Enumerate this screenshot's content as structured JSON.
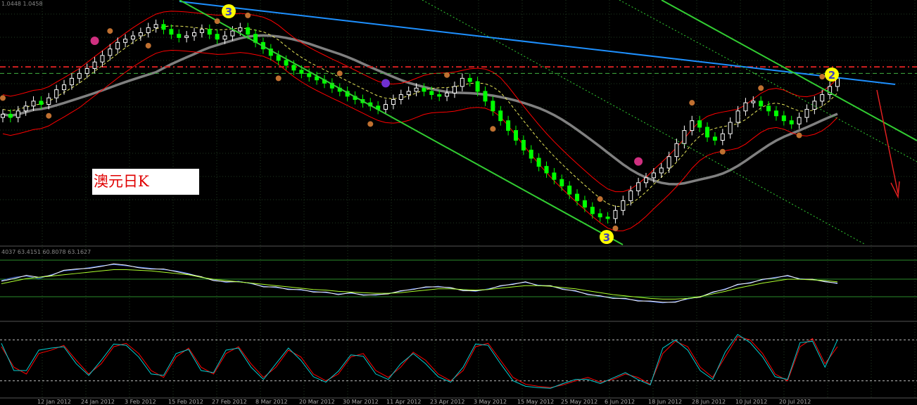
{
  "chart_data": [
    {
      "type": "candlestick",
      "panel": "main",
      "instrument_hint": "AUD daily",
      "header_text": "1.0448 1.0458",
      "annotation_label": "澳元日K",
      "x_tick_labels": [
        "12 Jan 2012",
        "24 Jan 2012",
        "3 Feb 2012",
        "15 Feb 2012",
        "27 Feb 2012",
        "8 Mar 2012",
        "20 Mar 2012",
        "30 Mar 2012",
        "11 Apr 2012",
        "23 Apr 2012",
        "3 May 2012",
        "15 May 2012",
        "25 May 2012",
        "6 Jun 2012",
        "18 Jun 2012",
        "28 Jun 2012",
        "10 Jul 2012",
        "20 Jul 2012"
      ],
      "close_series": [
        1.03,
        1.028,
        1.032,
        1.035,
        1.038,
        1.036,
        1.04,
        1.045,
        1.048,
        1.052,
        1.055,
        1.058,
        1.062,
        1.066,
        1.07,
        1.074,
        1.076,
        1.078,
        1.08,
        1.083,
        1.085,
        1.082,
        1.079,
        1.077,
        1.078,
        1.08,
        1.082,
        1.079,
        1.076,
        1.078,
        1.081,
        1.083,
        1.079,
        1.074,
        1.07,
        1.066,
        1.063,
        1.06,
        1.057,
        1.055,
        1.053,
        1.051,
        1.049,
        1.046,
        1.044,
        1.041,
        1.039,
        1.037,
        1.035,
        1.033,
        1.036,
        1.039,
        1.042,
        1.044,
        1.046,
        1.044,
        1.042,
        1.041,
        1.043,
        1.047,
        1.052,
        1.05,
        1.044,
        1.038,
        1.032,
        1.026,
        1.02,
        1.014,
        1.008,
        1.003,
        0.998,
        0.994,
        0.99,
        0.986,
        0.981,
        0.977,
        0.973,
        0.969,
        0.967,
        0.966,
        0.971,
        0.977,
        0.983,
        0.988,
        0.991,
        0.994,
        0.997,
        1.004,
        1.012,
        1.02,
        1.026,
        1.022,
        1.016,
        1.014,
        1.018,
        1.025,
        1.032,
        1.037,
        1.038,
        1.035,
        1.032,
        1.029,
        1.026,
        1.024,
        1.028,
        1.033,
        1.038,
        1.042,
        1.047,
        1.052
      ],
      "reference_lines": {
        "red_dash_level": 1.059,
        "green_dash_level": 1.055
      },
      "moving_average_grey": "thick grey line",
      "bands": "red envelope lines, yellow dashed mid line",
      "trend_lines": [
        "blue descending resistance",
        "green descending channel",
        "green dotted parallel lines"
      ],
      "markers": [
        {
          "label": "3",
          "color": "yellow",
          "where": "late Feb high"
        },
        {
          "label": "3",
          "color": "yellow",
          "where": "late May low"
        },
        {
          "label": "2",
          "color": "yellow",
          "where": "late Jul"
        }
      ],
      "colors": {
        "up": "#ffffff",
        "down": "#00ff00",
        "band": "#ff0000",
        "ma": "#808080",
        "trend_blue": "#1e90ff",
        "trend_green": "#32cd32"
      }
    },
    {
      "type": "line",
      "panel": "oscillator-1",
      "header_text": "4037 63.4151 60.8078 63.1627",
      "series": [
        {
          "color": "#4169e1",
          "values": [
            55,
            60,
            62,
            58,
            64,
            70,
            72,
            75,
            78,
            80,
            78,
            76,
            74,
            72,
            70,
            66,
            60,
            56,
            52,
            54,
            50,
            46,
            44,
            42,
            40,
            38,
            36,
            34,
            35,
            33,
            32,
            35,
            38,
            42,
            44,
            46,
            43,
            40,
            38,
            42,
            46,
            50,
            52,
            48,
            46,
            42,
            38,
            34,
            30,
            28,
            26,
            24,
            22,
            20,
            22,
            26,
            30,
            36,
            42,
            48,
            52,
            56,
            60,
            62,
            58,
            56,
            54,
            50
          ]
        },
        {
          "color": "#ffffff",
          "values": [
            54,
            58,
            63,
            60,
            63,
            71,
            73,
            74,
            77,
            81,
            79,
            75,
            73,
            73,
            69,
            65,
            61,
            55,
            53,
            53,
            51,
            45,
            45,
            41,
            41,
            37,
            37,
            33,
            36,
            32,
            33,
            34,
            39,
            41,
            45,
            45,
            44,
            39,
            39,
            41,
            47,
            49,
            53,
            47,
            47,
            41,
            39,
            33,
            31,
            27,
            27,
            23,
            23,
            21,
            21,
            27,
            29,
            37,
            41,
            49,
            51,
            57,
            59,
            63,
            57,
            57,
            53,
            51
          ]
        },
        {
          "color": "#adff2f",
          "values": [
            50,
            54,
            58,
            60,
            62,
            64,
            66,
            68,
            70,
            72,
            72,
            71,
            70,
            68,
            66,
            64,
            60,
            57,
            55,
            53,
            51,
            49,
            47,
            45,
            43,
            41,
            40,
            38,
            37,
            36,
            35,
            35,
            36,
            38,
            40,
            42,
            42,
            41,
            40,
            41,
            43,
            45,
            47,
            47,
            46,
            44,
            42,
            39,
            36,
            33,
            31,
            29,
            27,
            26,
            26,
            27,
            30,
            34,
            38,
            43,
            47,
            51,
            54,
            57,
            57,
            56,
            55,
            53
          ]
        }
      ],
      "ylim": [
        0,
        100
      ]
    },
    {
      "type": "line",
      "panel": "oscillator-2",
      "series": [
        {
          "color": "#ff0000",
          "values": [
            70,
            40,
            30,
            60,
            65,
            72,
            50,
            30,
            45,
            70,
            75,
            60,
            35,
            25,
            55,
            68,
            40,
            30,
            60,
            70,
            45,
            25,
            40,
            65,
            55,
            30,
            20,
            30,
            55,
            60,
            35,
            25,
            40,
            62,
            50,
            30,
            20,
            35,
            70,
            75,
            50,
            25,
            15,
            12,
            10,
            14,
            20,
            25,
            18,
            22,
            30,
            25,
            15,
            60,
            78,
            70,
            40,
            25,
            55,
            85,
            80,
            60,
            30,
            20,
            70,
            82,
            45,
            70
          ]
        },
        {
          "color": "#00ced1",
          "values": [
            75,
            35,
            35,
            65,
            68,
            70,
            45,
            28,
            50,
            74,
            72,
            55,
            30,
            28,
            60,
            66,
            35,
            32,
            65,
            68,
            40,
            22,
            45,
            68,
            50,
            26,
            18,
            34,
            58,
            56,
            30,
            22,
            45,
            60,
            45,
            26,
            18,
            40,
            74,
            72,
            45,
            20,
            12,
            10,
            9,
            16,
            22,
            22,
            16,
            24,
            32,
            22,
            14,
            68,
            80,
            65,
            35,
            22,
            62,
            88,
            76,
            55,
            26,
            22,
            76,
            78,
            40,
            80
          ]
        }
      ],
      "ylim": [
        0,
        100
      ],
      "levels": [
        80,
        20
      ]
    }
  ]
}
